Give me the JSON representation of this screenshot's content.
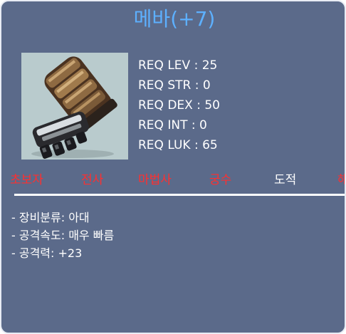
{
  "item": {
    "title": "메바(+7)",
    "icon": "gauntlet-claw-icon"
  },
  "requirements": [
    "REQ LEV : 25",
    "REQ STR : 0",
    "REQ DEX : 50",
    "REQ INT : 0",
    "REQ LUK : 65"
  ],
  "jobs": [
    {
      "label": "초보자",
      "color": "#ff2f2f"
    },
    {
      "label": "전사",
      "color": "#ff2f2f"
    },
    {
      "label": "마법사",
      "color": "#ff2f2f"
    },
    {
      "label": "궁수",
      "color": "#ff2f2f"
    },
    {
      "label": "도적",
      "color": "#ffffff"
    },
    {
      "label": "해적",
      "color": "#ff2f2f"
    }
  ],
  "details": [
    "- 장비분류: 아대",
    "- 공격속도: 매우 빠름",
    "- 공격력: +23"
  ],
  "colors": {
    "title": "#5db0ff",
    "background": "#5b6a8a",
    "job_available": "#ffffff",
    "job_unavailable": "#ff2f2f"
  }
}
